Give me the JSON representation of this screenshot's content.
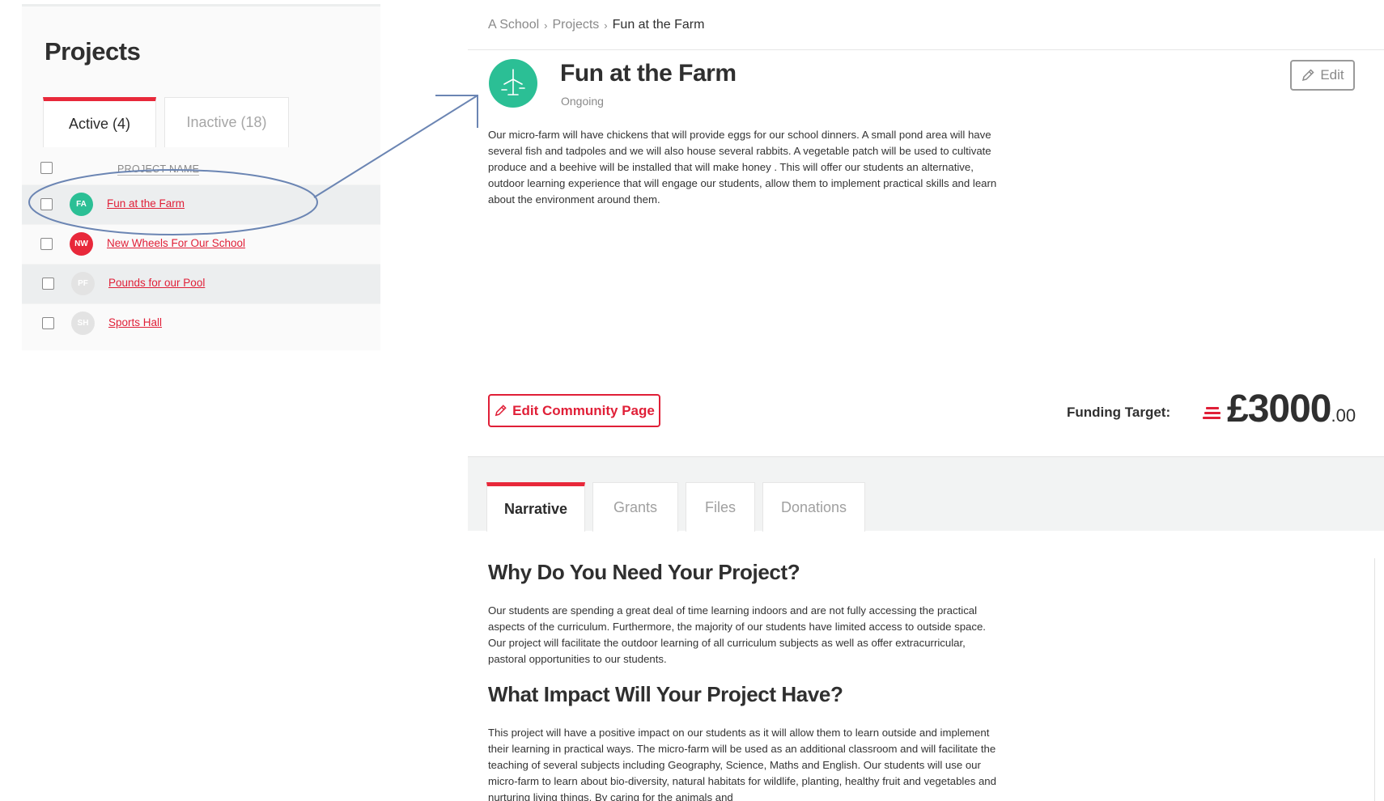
{
  "left_panel": {
    "title": "Projects",
    "tabs": [
      {
        "label": "Active (4)"
      },
      {
        "label": "Inactive (18)"
      }
    ],
    "column_header": "PROJECT NAME",
    "rows": [
      {
        "initials": "FA",
        "name": "Fun at the Farm",
        "avatar_color": "#2bbf95"
      },
      {
        "initials": "NW",
        "name": "New Wheels For Our School",
        "avatar_color": "#e8283a"
      },
      {
        "initials": "PF",
        "name": "Pounds for our Pool",
        "avatar_color": "#e3e3e3"
      },
      {
        "initials": "SH",
        "name": "Sports Hall",
        "avatar_color": "#e3e3e3"
      }
    ]
  },
  "breadcrumb": {
    "items": [
      "A School",
      "Projects",
      "Fun at the Farm"
    ]
  },
  "project": {
    "icon": "wind-turbine-icon",
    "title": "Fun at the Farm",
    "status": "Ongoing",
    "edit_label": "Edit",
    "description": "Our micro-farm will have chickens that will provide eggs for our school dinners. A small pond area will have several fish and tadpoles and we will also house several rabbits. A vegetable patch will be used to cultivate produce and a beehive will be installed that will make honey . This will offer our students an alternative, outdoor learning experience that will engage our students, allow them to implement practical skills and learn about the environment around them.",
    "community_button_label": "Edit Community Page",
    "funding_label": "Funding Target:",
    "funding_amount": "£3000",
    "funding_cents": ".00"
  },
  "detail_tabs": [
    {
      "label": "Narrative"
    },
    {
      "label": "Grants"
    },
    {
      "label": "Files"
    },
    {
      "label": "Donations"
    }
  ],
  "narrative": {
    "section1_title": "Why Do You Need Your Project?",
    "section1_text": "Our students are spending a great deal of time learning indoors and are not fully accessing the practical aspects of the curriculum. Furthermore, the majority of our students have limited access to outside space. Our project will facilitate the outdoor learning of all curriculum subjects as well as offer extracurricular, pastoral opportunities to our students.",
    "section2_title": "What Impact Will Your Project Have?",
    "section2_text": "This project will have a positive impact on our students as it will allow them to learn outside and implement their learning in practical ways. The micro-farm will be used as an additional classroom and will facilitate the teaching of several subjects including Geography, Science, Maths and English. Our students will use our micro-farm to learn about bio-diversity, natural habitats for wildlife, planting, healthy fruit and vegetables and nurturing living things. By caring for the animals and"
  },
  "colors": {
    "accent_red": "#e8283a",
    "link_red": "#e01f37",
    "teal": "#2bbf95",
    "annotation_blue": "#6b85b3"
  }
}
